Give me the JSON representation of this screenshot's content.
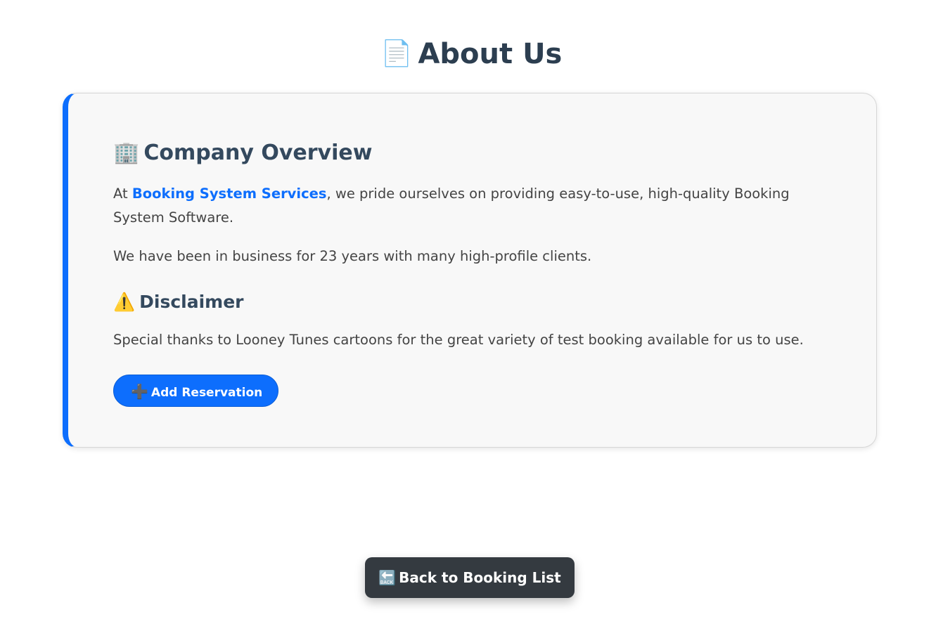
{
  "page": {
    "title": "About Us",
    "title_icon": "📄"
  },
  "overview": {
    "icon": "🏢",
    "heading": "Company Overview",
    "para1_prefix": "At ",
    "company_name": "Booking System Services",
    "para1_suffix": ", we pride ourselves on providing easy-to-use, high-quality Booking System Software.",
    "para2": "We have been in business for 23 years with many high-profile clients."
  },
  "disclaimer": {
    "icon": "⚠️",
    "heading": "Disclaimer",
    "text": "Special thanks to Looney Tunes cartoons for the great variety of test booking available for us to use."
  },
  "actions": {
    "add_icon": "➕",
    "add_label": "Add Reservation",
    "back_icon": "🔙",
    "back_label": "Back to Booking List"
  },
  "colors": {
    "accent": "#0d6efd",
    "heading": "#2c3e50",
    "back_button": "#343a40"
  },
  "icons": {
    "title": "document-icon",
    "overview": "office-building-icon",
    "disclaimer": "warning-icon",
    "add": "plus-icon",
    "back": "back-arrow-icon"
  }
}
